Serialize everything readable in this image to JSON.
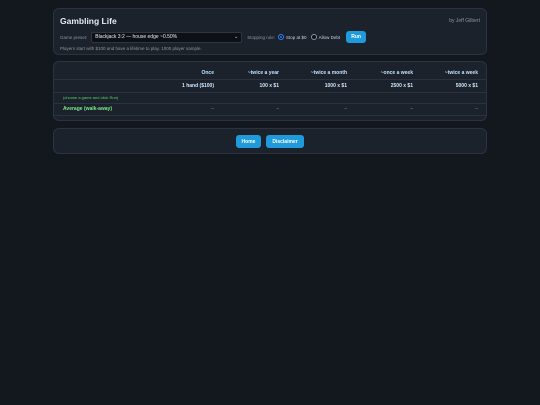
{
  "header": {
    "title": "Gambling Life",
    "author": "by Jeff Gilbert",
    "preset_label": "Game preset:",
    "preset_value": "Blackjack 3:2 — house edge ~0.50%",
    "stopping_label": "Stopping rule:",
    "stop_option": "Stop at $0",
    "debt_option": "Allow Debt",
    "selected_rule": "stop",
    "run_label": "Run",
    "hint": "Players start with $100 and have a lifetime to play. 1000 player sample."
  },
  "table": {
    "columns": [
      "Once",
      "~twice a year",
      "~twice a month",
      "~once a week",
      "~twice a week"
    ],
    "subheads": [
      "1 hand ($100)",
      "100 x $1",
      "1000 x $1",
      "2500 x $1",
      "5000 x $1"
    ],
    "prompt": "(choose a game and click Run)",
    "avg_label": "Average (walk-away)",
    "avg_values": [
      "–",
      "–",
      "–",
      "–",
      "–"
    ]
  },
  "footer": {
    "home_label": "Home",
    "disclaimer_label": "Disclaimer"
  },
  "colors": {
    "background": "#13181f",
    "card": "#1b222c",
    "accent": "#1f9bdb",
    "positive": "#7ee787",
    "header_text": "#bfe3ff"
  }
}
